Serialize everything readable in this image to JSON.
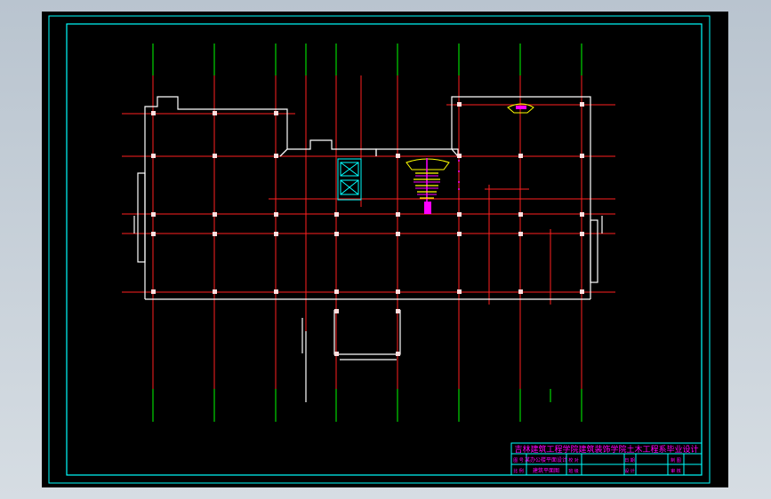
{
  "title_block": {
    "header": "吉林建筑工程学院建筑装饰学院土木工程系毕业设计",
    "drawing_name": "建筑平面图",
    "cells": [
      "图 号",
      "比 例",
      "日 期",
      "设 计",
      "制 图",
      "审 核",
      "校 对",
      "班 级"
    ],
    "subject": "某办公楼平面设计"
  },
  "colors": {
    "background": "#000000",
    "border": "#00ffff",
    "axis_red": "#ff2020",
    "axis_green": "#00ff00",
    "wall": "#ffffff",
    "annotation": "#ff00ff",
    "stair": "#ffff00"
  }
}
